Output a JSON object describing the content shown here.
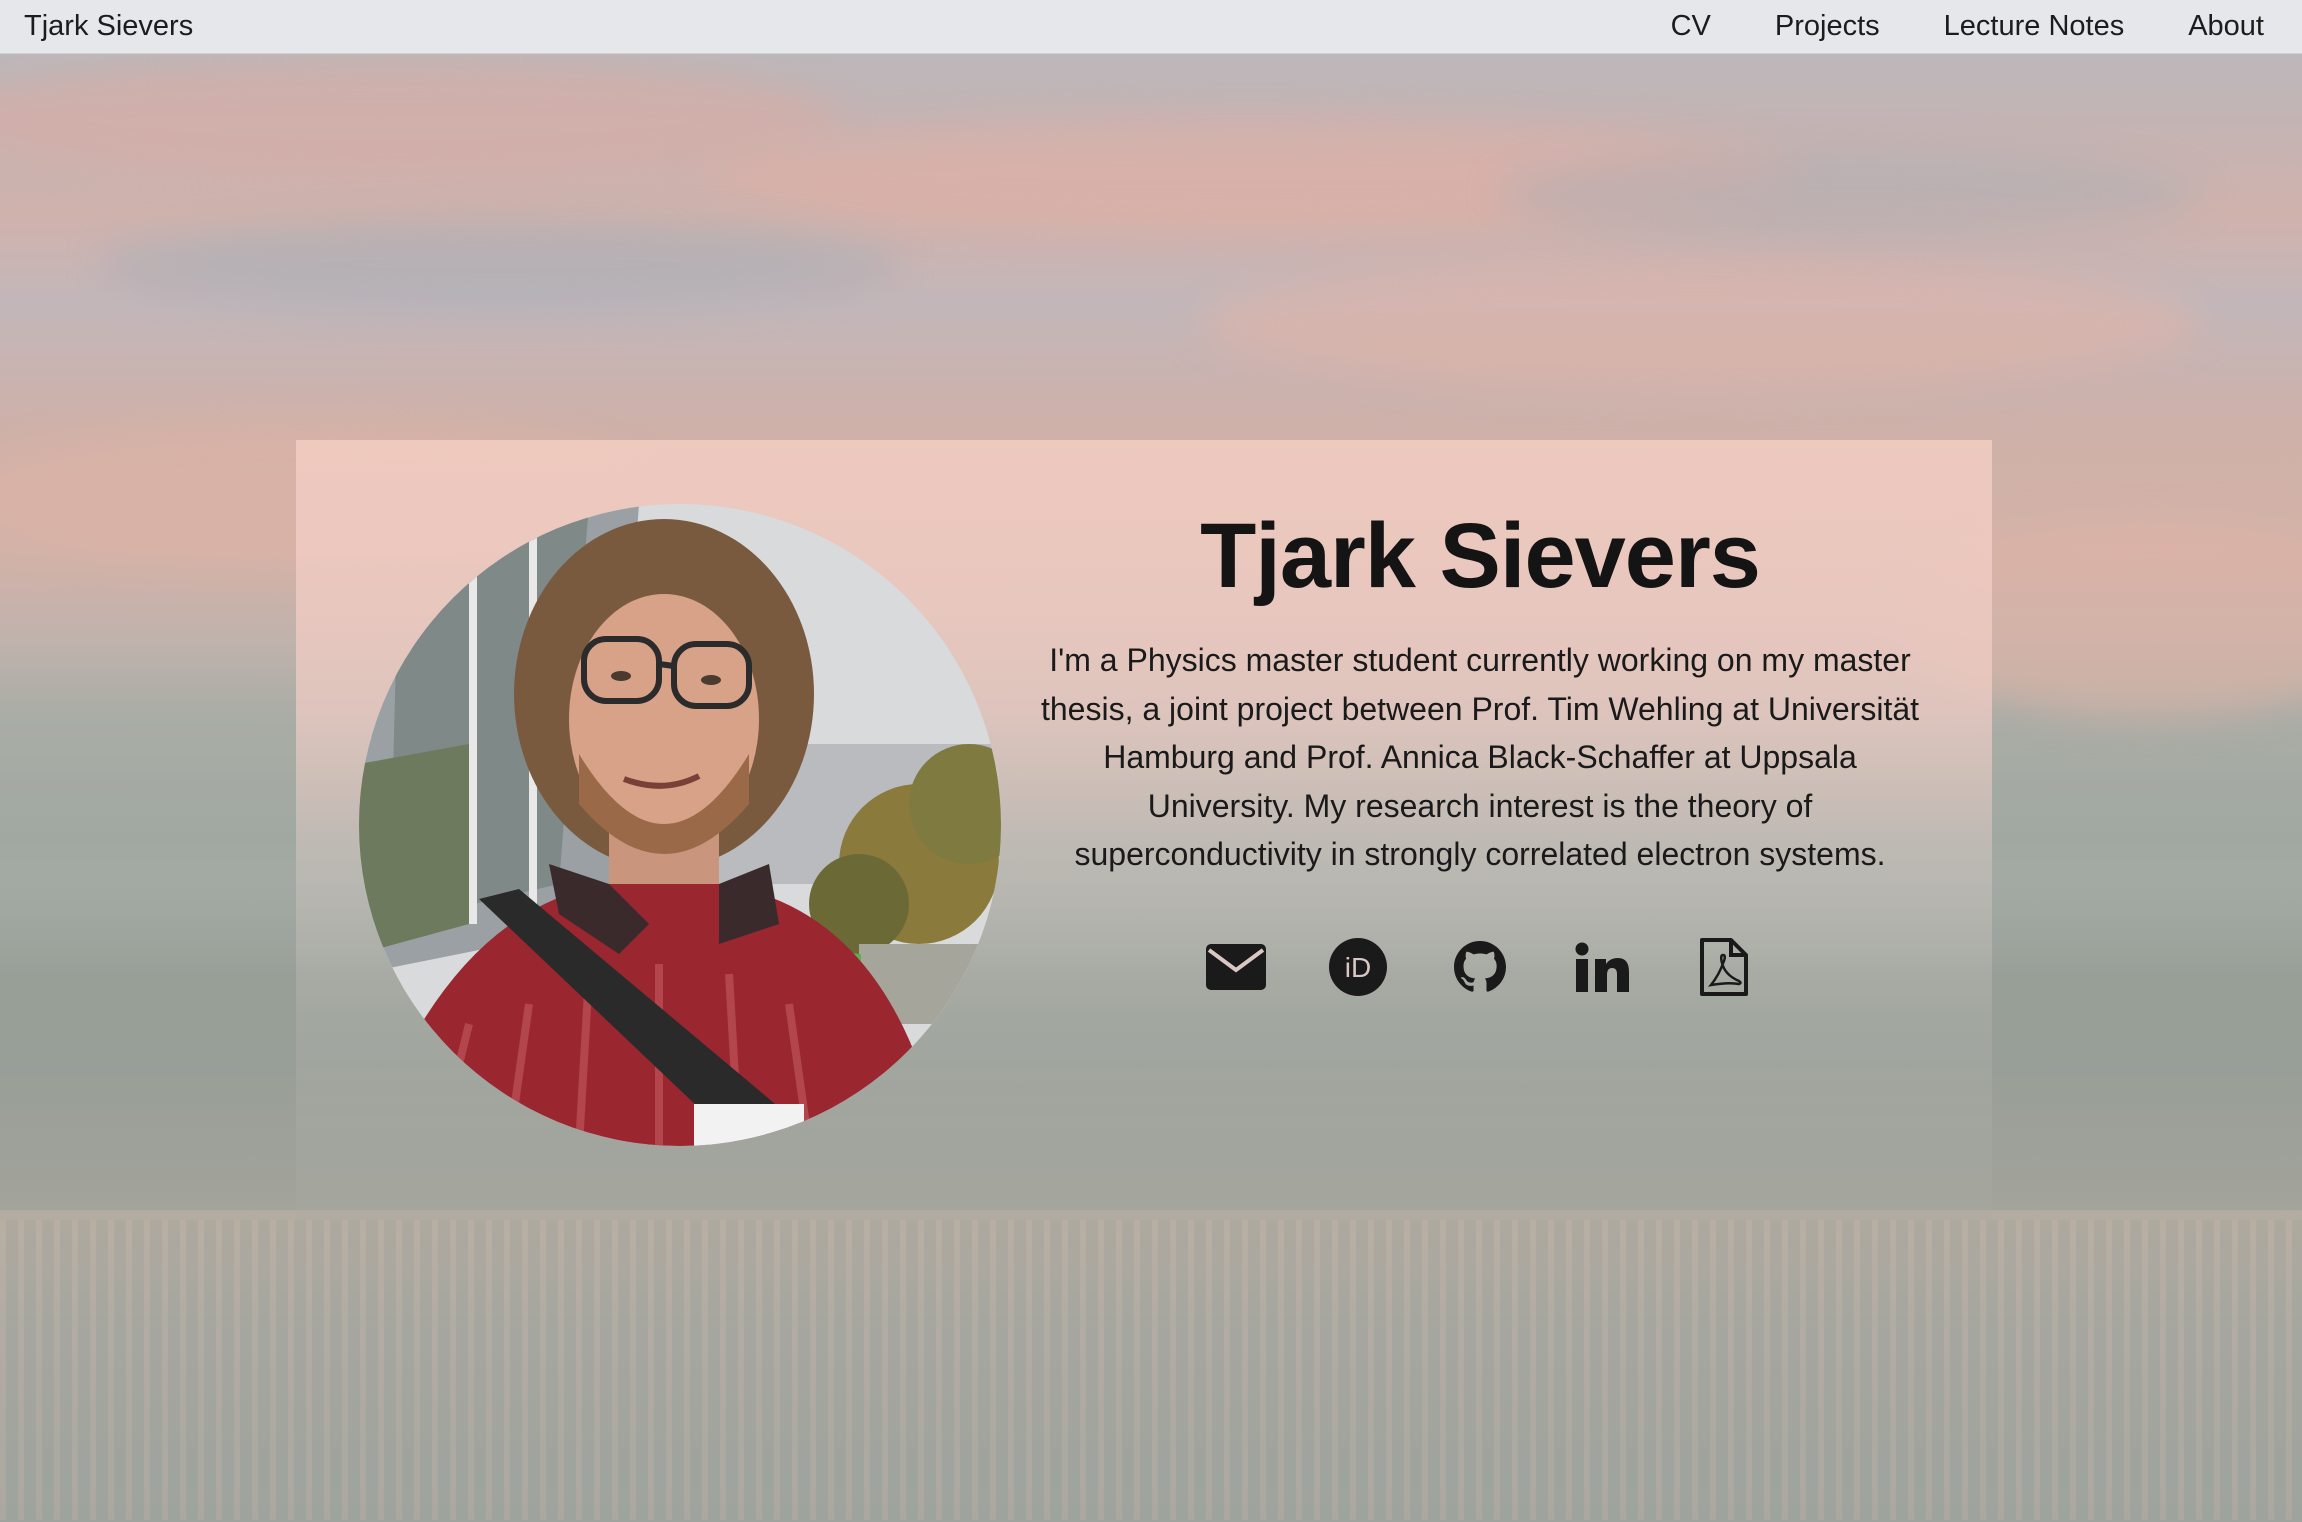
{
  "navbar": {
    "brand": "Tjark Sievers",
    "links": [
      {
        "label": "CV"
      },
      {
        "label": "Projects"
      },
      {
        "label": "Lecture Notes"
      },
      {
        "label": "About"
      }
    ]
  },
  "hero": {
    "name": "Tjark Sievers",
    "bio": "I'm a Physics master student currently working on my master thesis, a joint project between Prof. Tim Wehling at Universität Hamburg and Prof. Annica Black-Schaffer at Uppsala University. My research interest is the theory of superconductivity in strongly correlated electron systems.",
    "social_icons": [
      "email-icon",
      "orcid-icon",
      "github-icon",
      "linkedin-icon",
      "pdf-icon"
    ],
    "orcid_glyph": "iD",
    "linkedin_glyph": "in"
  },
  "colors": {
    "navbar_bg": "#e6e7ea",
    "text": "#141414",
    "icon": "#1a1a1a"
  }
}
